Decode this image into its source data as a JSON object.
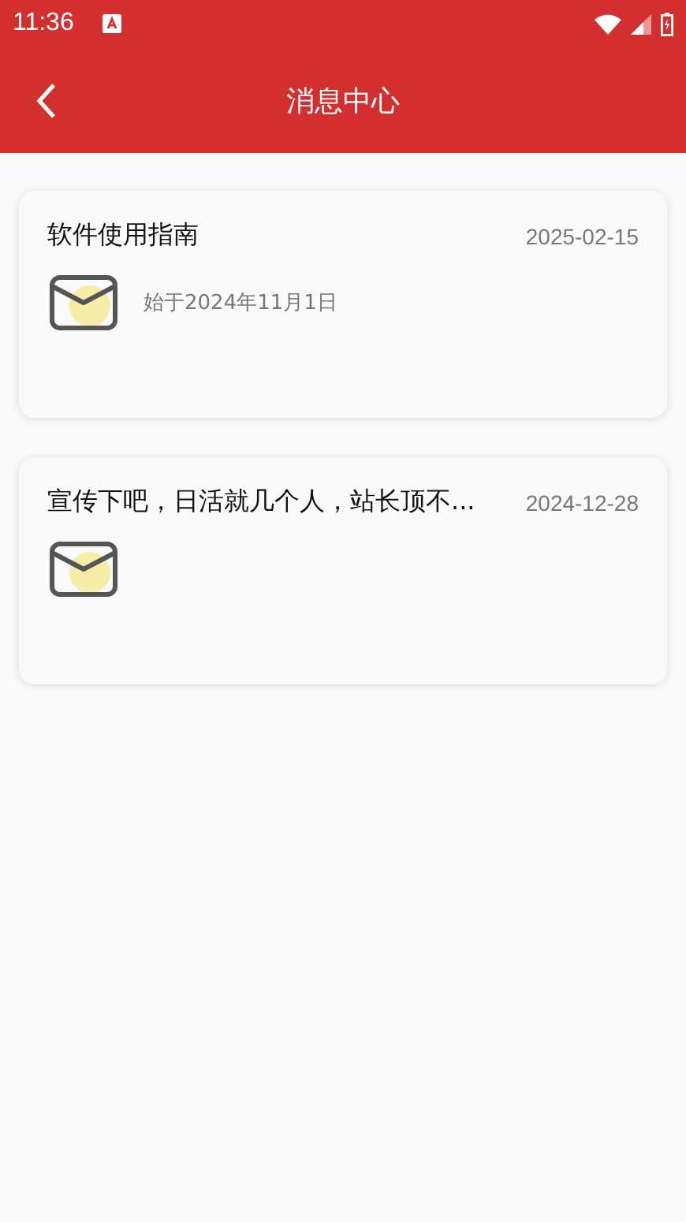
{
  "status_bar": {
    "time": "11:36"
  },
  "header": {
    "title": "消息中心"
  },
  "messages": [
    {
      "title": "软件使用指南",
      "date": "2025-02-15",
      "subtitle": "始于2024年11月1日"
    },
    {
      "title": "宣传下吧，日活就几个人，站长顶不...",
      "date": "2024-12-28"
    }
  ]
}
